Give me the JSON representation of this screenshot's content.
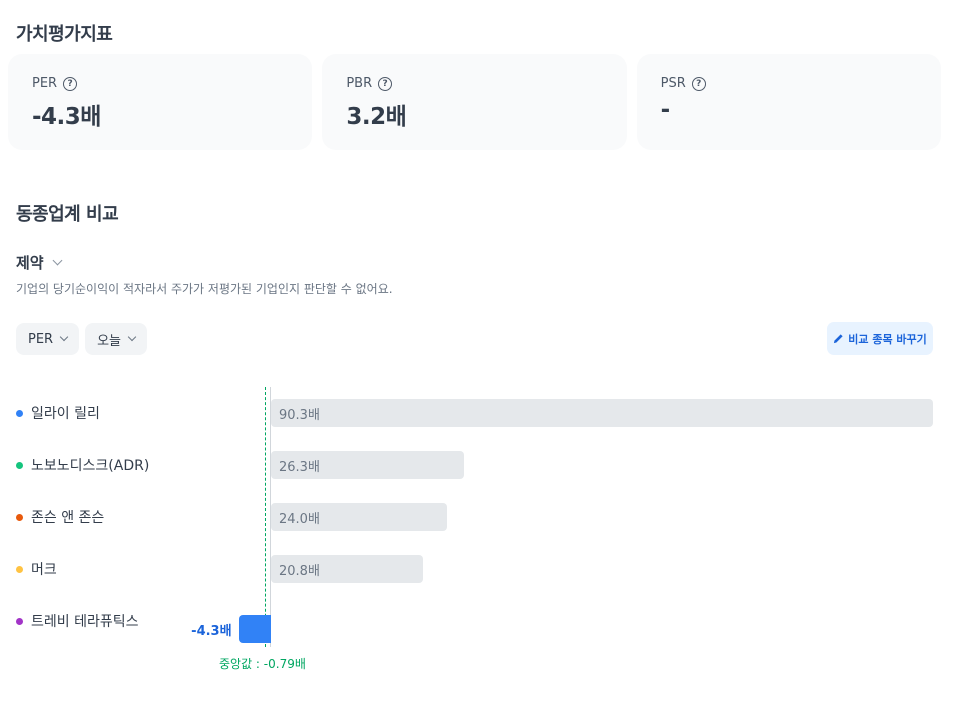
{
  "valuation": {
    "title": "가치평가지표",
    "cards": [
      {
        "label": "PER",
        "value": "-4.3배"
      },
      {
        "label": "PBR",
        "value": "3.2배"
      },
      {
        "label": "PSR",
        "value": "-"
      }
    ]
  },
  "peer": {
    "title": "동종업계 비교",
    "industry": "제약",
    "description": "기업의 당기순이익이 적자라서 주가가 저평가된 기업인지 판단할 수 없어요.",
    "filters": {
      "metric": "PER",
      "period": "오늘"
    },
    "change_button": "비교 종목 바꾸기",
    "median_label": "중앙값 : -0.79배"
  },
  "colors": {
    "accent": "#3182f6",
    "median": "#00a661",
    "bar": "#e5e8eb"
  },
  "chart_data": {
    "type": "bar",
    "orientation": "horizontal",
    "categories": [
      "일라이 릴리",
      "노보노디스크(ADR)",
      "존슨 앤 존슨",
      "머크",
      "트레비 테라퓨틱스"
    ],
    "values": [
      90.3,
      26.3,
      24.0,
      20.8,
      -4.3
    ],
    "value_labels": [
      "90.3배",
      "26.3배",
      "24.0배",
      "20.8배",
      "-4.3배"
    ],
    "dot_colors": [
      "#3182f6",
      "#15c47e",
      "#e8590c",
      "#ffc342",
      "#a234c7"
    ],
    "median": -0.79
  }
}
